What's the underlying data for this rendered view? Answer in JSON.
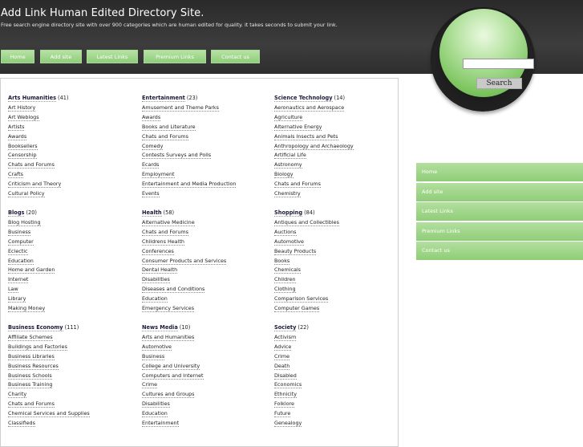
{
  "site": {
    "title": "Add Link Human Edited Directory Site.",
    "tagline": "Free search engine directory site with over 900 categories which are human edited for quality. it takes seconds to submit your link."
  },
  "nav": [
    "Home",
    "Add site",
    "Latest Links",
    "Premium Links",
    "Contact us"
  ],
  "search": {
    "placeholder": "",
    "button": "Search"
  },
  "side_nav": [
    "Home",
    "Add site",
    "Latest Links",
    "Premium Links",
    "Contact us"
  ],
  "categories": [
    {
      "name": "Arts Humanities",
      "count": "(41)",
      "subs": [
        "Art History",
        "Art Weblogs",
        "Artists",
        "Awards",
        "Booksellers",
        "Censorship",
        "Chats and Forums",
        "Crafts",
        "Criticism and Theory",
        "Cultural Policy"
      ]
    },
    {
      "name": "Entertainment",
      "count": "(23)",
      "subs": [
        "Amusement and Theme Parks",
        "Awards",
        "Books and Literature",
        "Chats and Forums",
        "Comedy",
        "Contests Surveys and Polls",
        "Ecards",
        "Employment",
        "Entertainment and Media Production",
        "Events"
      ]
    },
    {
      "name": "Science Technology",
      "count": "(14)",
      "subs": [
        "Aeronautics and Aerospace",
        "Agriculture",
        "Alternative Energy",
        "Animals Insects and Pets",
        "Anthropology and Archaeology",
        "Artificial Life",
        "Astronomy",
        "Biology",
        "Chats and Forums",
        "Chemistry"
      ]
    },
    {
      "name": "Blogs",
      "count": "(20)",
      "subs": [
        "Blog Hosting",
        "Business",
        "Computer",
        "Eclectic",
        "Education",
        "Home and Garden",
        "Internet",
        "Law",
        "Library",
        "Making Money"
      ]
    },
    {
      "name": "Health",
      "count": "(58)",
      "subs": [
        "Alternative Medicine",
        "Chats and Forums",
        "Childrens Health",
        "Conferences",
        "Consumer Products and Services",
        "Dental Health",
        "Disabilities",
        "Diseases and Conditions",
        "Education",
        "Emergency Services"
      ]
    },
    {
      "name": "Shopping",
      "count": "(84)",
      "subs": [
        "Antiques and Collectibles",
        "Auctions",
        "Automotive",
        "Beauty Products",
        "Books",
        "Chemicals",
        "Children",
        "Clothing",
        "Comparison Services",
        "Computer Games"
      ]
    },
    {
      "name": "Business Economy",
      "count": "(111)",
      "subs": [
        "Affiliate Schemes",
        "Buildings and Factories",
        "Business Libraries",
        "Business Resources",
        "Business Schools",
        "Business Training",
        "Charity",
        "Chats and Forums",
        "Chemical Services and Supplies",
        "Classifieds"
      ]
    },
    {
      "name": "News Media",
      "count": "(10)",
      "subs": [
        "Arts and Humanities",
        "Automotive",
        "Business",
        "College and University",
        "Computers and Internet",
        "Crime",
        "Cultures and Groups",
        "Disabilities",
        "Education",
        "Entertainment"
      ]
    },
    {
      "name": "Society",
      "count": "(22)",
      "subs": [
        "Activism",
        "Advice",
        "Crime",
        "Death",
        "Disabled",
        "Economics",
        "Ethnicity",
        "Folklore",
        "Future",
        "Genealogy"
      ]
    }
  ]
}
